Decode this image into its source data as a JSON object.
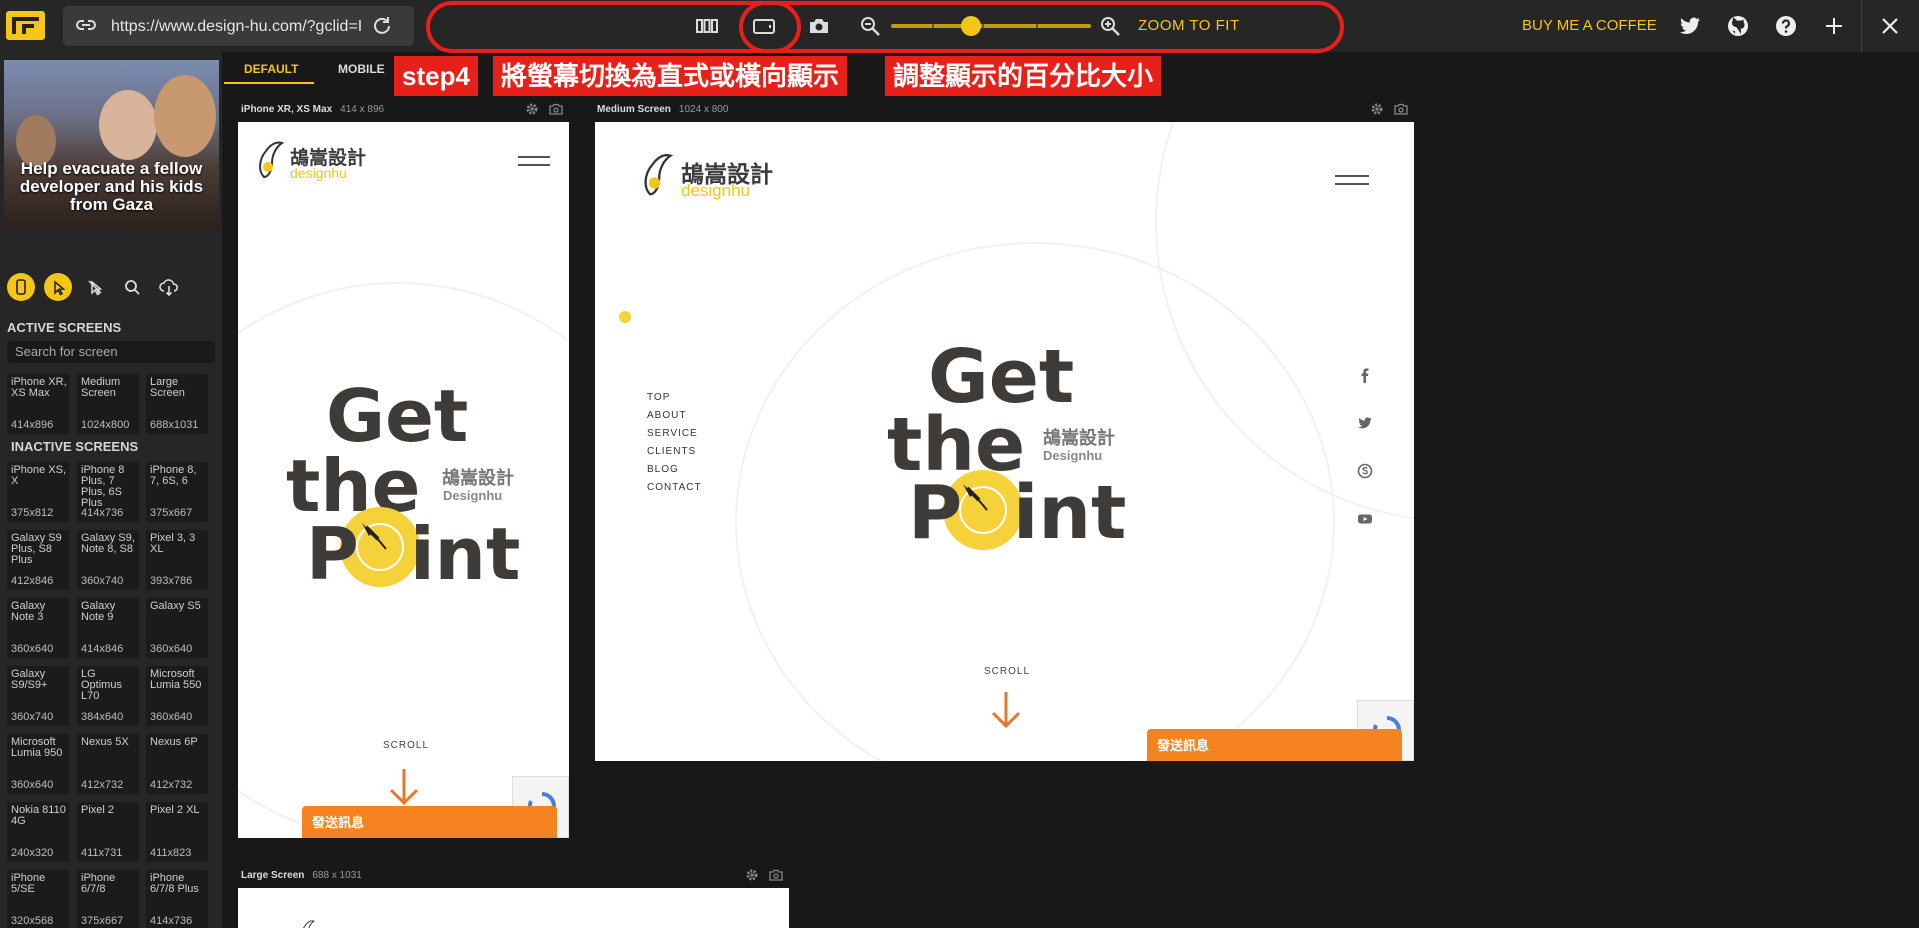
{
  "topbar": {
    "url": "https://www.design-hu.com/?gclid=I",
    "zoom_to_fit": "ZOOM TO FIT",
    "buy_coffee": "BUY ME A COFFEE",
    "zoom_level": 0.4
  },
  "sidebar": {
    "ad_text": "Help evacuate a fellow developer and his kids from Gaza",
    "active_heading": "ACTIVE SCREENS",
    "search_placeholder": "Search for screen",
    "inactive_heading": "INACTIVE SCREENS",
    "active_screens": [
      {
        "name": "iPhone XR, XS Max",
        "size": "414x896"
      },
      {
        "name": "Medium Screen",
        "size": "1024x800"
      },
      {
        "name": "Large Screen",
        "size": "688x1031"
      }
    ],
    "inactive_screens": [
      {
        "name": "iPhone XS, X",
        "size": "375x812"
      },
      {
        "name": "iPhone 8 Plus, 7 Plus, 6S Plus",
        "size": "414x736"
      },
      {
        "name": "iPhone 8, 7, 6S, 6",
        "size": "375x667"
      },
      {
        "name": "Galaxy S9 Plus, S8 Plus",
        "size": "412x846"
      },
      {
        "name": "Galaxy S9, Note 8, S8",
        "size": "360x740"
      },
      {
        "name": "Pixel 3, 3 XL",
        "size": "393x786"
      },
      {
        "name": "Galaxy Note 3",
        "size": "360x640"
      },
      {
        "name": "Galaxy Note 9",
        "size": "414x846"
      },
      {
        "name": "Galaxy S5",
        "size": "360x640"
      },
      {
        "name": "Galaxy S9/S9+",
        "size": "360x740"
      },
      {
        "name": "LG Optimus L70",
        "size": "384x640"
      },
      {
        "name": "Microsoft Lumia 550",
        "size": "360x640"
      },
      {
        "name": "Microsoft Lumia 950",
        "size": "360x640"
      },
      {
        "name": "Nexus 5X",
        "size": "412x732"
      },
      {
        "name": "Nexus 6P",
        "size": "412x732"
      },
      {
        "name": "Nokia 8110 4G",
        "size": "240x320"
      },
      {
        "name": "Pixel 2",
        "size": "411x731"
      },
      {
        "name": "Pixel 2 XL",
        "size": "411x823"
      },
      {
        "name": "iPhone 5/SE",
        "size": "320x568"
      },
      {
        "name": "iPhone 6/7/8",
        "size": "375x667"
      },
      {
        "name": "iPhone 6/7/8 Plus",
        "size": "414x736"
      }
    ]
  },
  "tabs": {
    "default": "DEFAULT",
    "mobile": "MOBILE"
  },
  "annotations": {
    "step": "step4",
    "orientation": "將螢幕切換為直式或橫向顯示",
    "zoom": "調整顯示的百分比大小"
  },
  "devices": {
    "iphone": {
      "name": "iPhone XR, XS Max",
      "size": "414 x 896"
    },
    "medium": {
      "name": "Medium Screen",
      "size": "1024 x 800"
    },
    "large": {
      "name": "Large Screen",
      "size": "688 x 1031"
    }
  },
  "site": {
    "brand_cn": "鴣嵩設計",
    "brand_en": "designhu",
    "hero_line1": "Get",
    "hero_line2": "the",
    "hero_line3_a": "P",
    "hero_line3_b": "int",
    "sub_cn": "鴣嵩設計",
    "sub_en": "Designhu",
    "scroll": "SCROLL",
    "message": "發送訊息",
    "nav": [
      "TOP",
      "ABOUT",
      "SERVICE",
      "CLIENTS",
      "BLOG",
      "CONTACT"
    ]
  },
  "colors": {
    "accent": "#f5c518",
    "annotation_red": "#e8201a",
    "message_orange": "#f5831f"
  }
}
